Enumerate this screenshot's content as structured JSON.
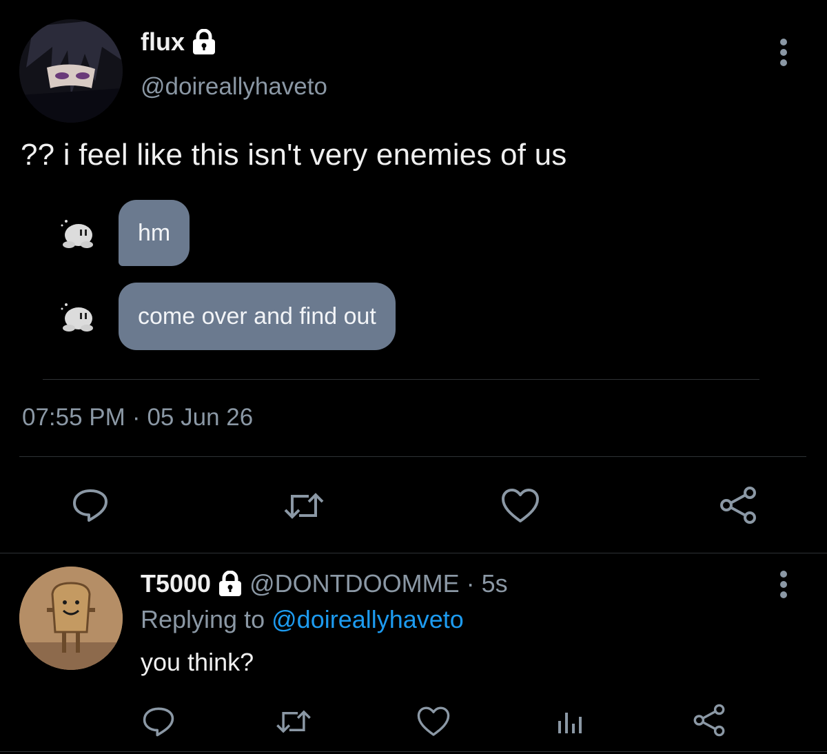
{
  "tweet": {
    "author_name": "flux",
    "author_handle": "@doireallyhaveto",
    "text": "?? i feel like this isn't very enemies of us",
    "messages": [
      {
        "text": "hm"
      },
      {
        "text": "come over and find out"
      }
    ],
    "time": "07:55 PM",
    "separator": "·",
    "date": "05 Jun 26",
    "actions": [
      "reply-icon",
      "retweet-icon",
      "like-icon",
      "share-icon"
    ]
  },
  "reply": {
    "author_name": "T5000",
    "author_handle": "@DONTDOOMME",
    "separator": "·",
    "age": "5s",
    "replying_prefix": "Replying to",
    "replying_to": "@doireallyhaveto",
    "text": "you think?",
    "actions": [
      "reply-icon",
      "retweet-icon",
      "like-icon",
      "analytics-icon",
      "share-icon"
    ]
  },
  "colors": {
    "background": "#000000",
    "secondary_text": "#8b98a5",
    "link": "#1d9bf0",
    "bubble": "#6b7a8f",
    "divider": "#2f3336"
  }
}
